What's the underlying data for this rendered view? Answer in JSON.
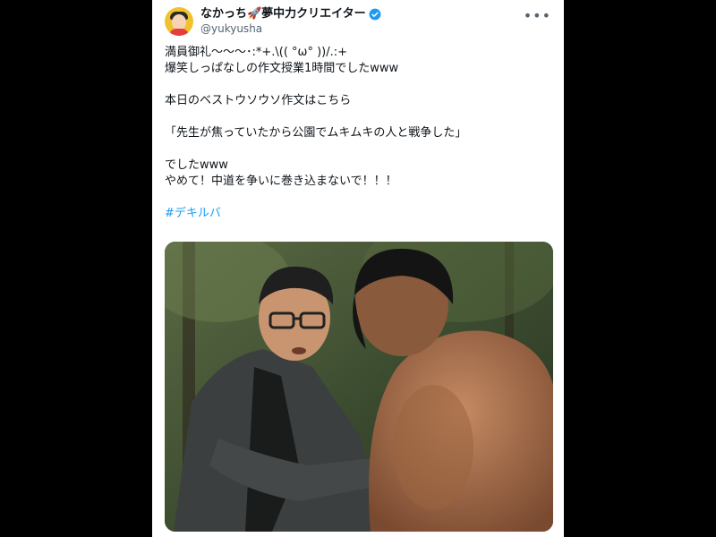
{
  "tweet": {
    "display_name": "なかっち🚀夢中力クリエイター",
    "handle": "@yukyusha",
    "more_icon": "more-dots-icon",
    "lines": [
      "満員御礼〜〜〜･:*+.\\(( °ω° ))/.:+",
      "爆笑しっぱなしの作文授業1時間でしたwww",
      "",
      "本日のベストウソウソ作文はこちら",
      "",
      "「先生が焦っていたから公園でムキムキの人と戦争した」",
      "",
      "でしたwww",
      "やめて！中道を争いに巻き込まないで！！！",
      ""
    ],
    "hashtag": "#デキルバ",
    "accent_color": "#1d9bf0"
  }
}
